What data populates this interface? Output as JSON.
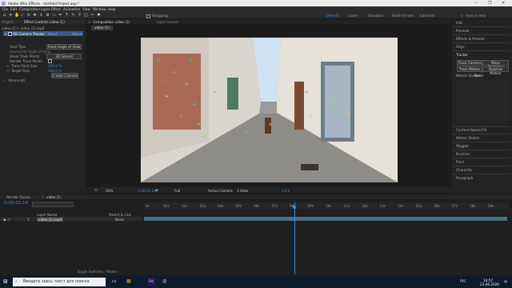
{
  "window": {
    "title": "Adobe After Effects - Untitled Project.aep *",
    "controls": [
      "—",
      "❐",
      "✕"
    ]
  },
  "menu": [
    "File",
    "Edit",
    "Composition",
    "Layer",
    "Effect",
    "Animation",
    "View",
    "Window",
    "Help"
  ],
  "toolbar": {
    "snapping_label": "Snapping",
    "workspaces": [
      "Default",
      "Learn",
      "Standard",
      "Small Screen",
      "Libraries"
    ],
    "active_workspace": "Default",
    "search_placeholder": "Search Help"
  },
  "effects_panel": {
    "tabs": [
      "Project",
      "Effect Controls video (1)"
    ],
    "breadcrumb": "video (1) • video (1).mp4",
    "effect_name": "3D Camera Tracker",
    "reset_label": "Reset",
    "about_label": "About",
    "rows": [
      {
        "label": "Shot Type",
        "value": "Fixed Angle of View"
      },
      {
        "label": "Horizontal Angle of View",
        "value": ""
      },
      {
        "label": "Show Track Points",
        "value": "3D Solved"
      },
      {
        "label": "Render Track Points",
        "value": ""
      },
      {
        "label": "Track Point Size",
        "value": "100.0 %"
      },
      {
        "label": "Target Size",
        "value": "100.0 %"
      }
    ],
    "create_camera_label": "Create Camera",
    "advanced_label": "Advanced"
  },
  "comp_panel": {
    "tab": "Composition video (1)",
    "layer_tab": "Layer (none)",
    "comp_tab": "video (1)",
    "footer": {
      "zoom": "50%",
      "timecode": "0;00;02;14",
      "resolution": "Full",
      "camera": "Active Camera",
      "views": "1 View",
      "exposure": "+0.0"
    }
  },
  "right_panel": {
    "items": [
      "Info",
      "Preview",
      "Effects & Presets",
      "Align",
      "Tracker"
    ],
    "tracker_buttons": [
      "Track Camera",
      "Warp Stabilizer",
      "Track Motion",
      "Stabilize Motion"
    ],
    "motion_source_label": "Motion Source:",
    "motion_source_value": "None",
    "bottom_items": [
      "Content-Aware Fill",
      "Motion Sketch",
      "Wiggler",
      "Brushes",
      "Paint",
      "Character",
      "Paragraph"
    ]
  },
  "timeline": {
    "tabs": [
      "Render Queue",
      "video (1)"
    ],
    "timecode": "0;00;02;14",
    "layer_header": "Layer Name",
    "parent_header": "Parent & Link",
    "layer": {
      "index": "1",
      "name": "video (1).mp4",
      "parent": "None"
    },
    "ruler": [
      "0s",
      "01s",
      "02s",
      "03s",
      "04s",
      "05s",
      "06s",
      "07s",
      "08s",
      "09s",
      "10s",
      "11s",
      "12s",
      "13s",
      "14s",
      "15s",
      "16s",
      "17s",
      "18s",
      "19s"
    ],
    "playhead_label": "02s",
    "footer": "Toggle Switches / Modes"
  },
  "taskbar": {
    "search_placeholder": "Введите здесь текст для поиска",
    "time": "14:57",
    "date": "23.06.2020",
    "lang": "РУС"
  }
}
